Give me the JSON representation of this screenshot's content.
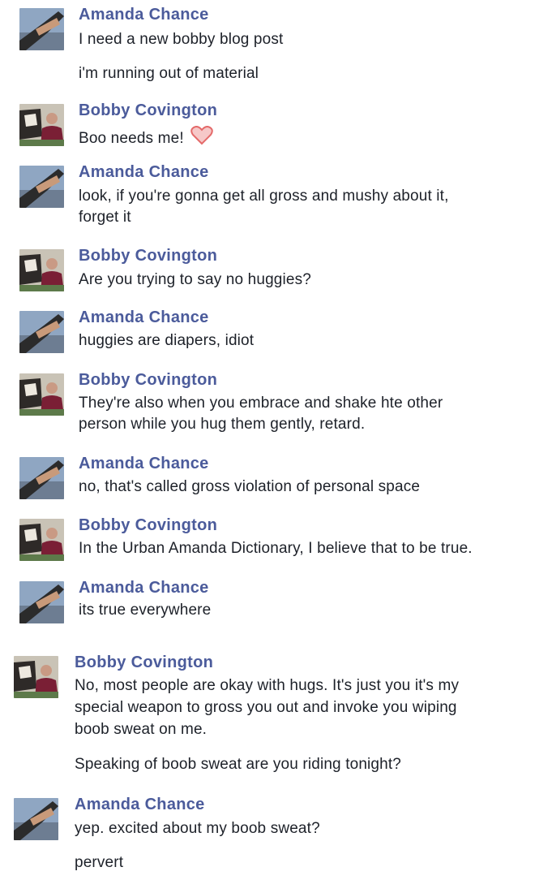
{
  "messages": [
    {
      "sender": "Amanda Chance",
      "lines": [
        "I need a new bobby blog post",
        "i'm running out of material"
      ]
    },
    {
      "sender": "Bobby Covington",
      "lines": [
        "Boo needs me!"
      ],
      "icon": "heart-icon"
    },
    {
      "sender": "Amanda Chance",
      "lines": [
        "look, if you're gonna get all gross and mushy about it,",
        "forget it"
      ]
    },
    {
      "sender": "Bobby Covington",
      "lines": [
        "Are you trying to say no huggies?"
      ]
    },
    {
      "sender": "Amanda Chance",
      "lines": [
        "huggies are diapers, idiot"
      ]
    },
    {
      "sender": "Bobby Covington",
      "lines": [
        "They're also when you embrace and shake hte other",
        "person while you hug them gently, retard."
      ]
    },
    {
      "sender": "Amanda Chance",
      "lines": [
        "no, that's called gross violation of personal space"
      ]
    },
    {
      "sender": "Bobby Covington",
      "lines": [
        "In the Urban Amanda Dictionary, I believe that to be true."
      ]
    },
    {
      "sender": "Amanda Chance",
      "lines": [
        "its true everywhere"
      ]
    },
    {
      "sender": "Bobby Covington",
      "lines": [
        "No, most people are okay with hugs.  It's just you it's my",
        "special weapon to gross you out and invoke you wiping",
        "boob sweat on me.",
        "Speaking of boob sweat are you riding tonight?"
      ]
    },
    {
      "sender": "Amanda Chance",
      "lines": [
        "yep. excited about my boob sweat?",
        "pervert"
      ]
    }
  ],
  "colors": {
    "sender": "#4b5b9b",
    "text": "#1d2129",
    "heart": "#f07070"
  }
}
